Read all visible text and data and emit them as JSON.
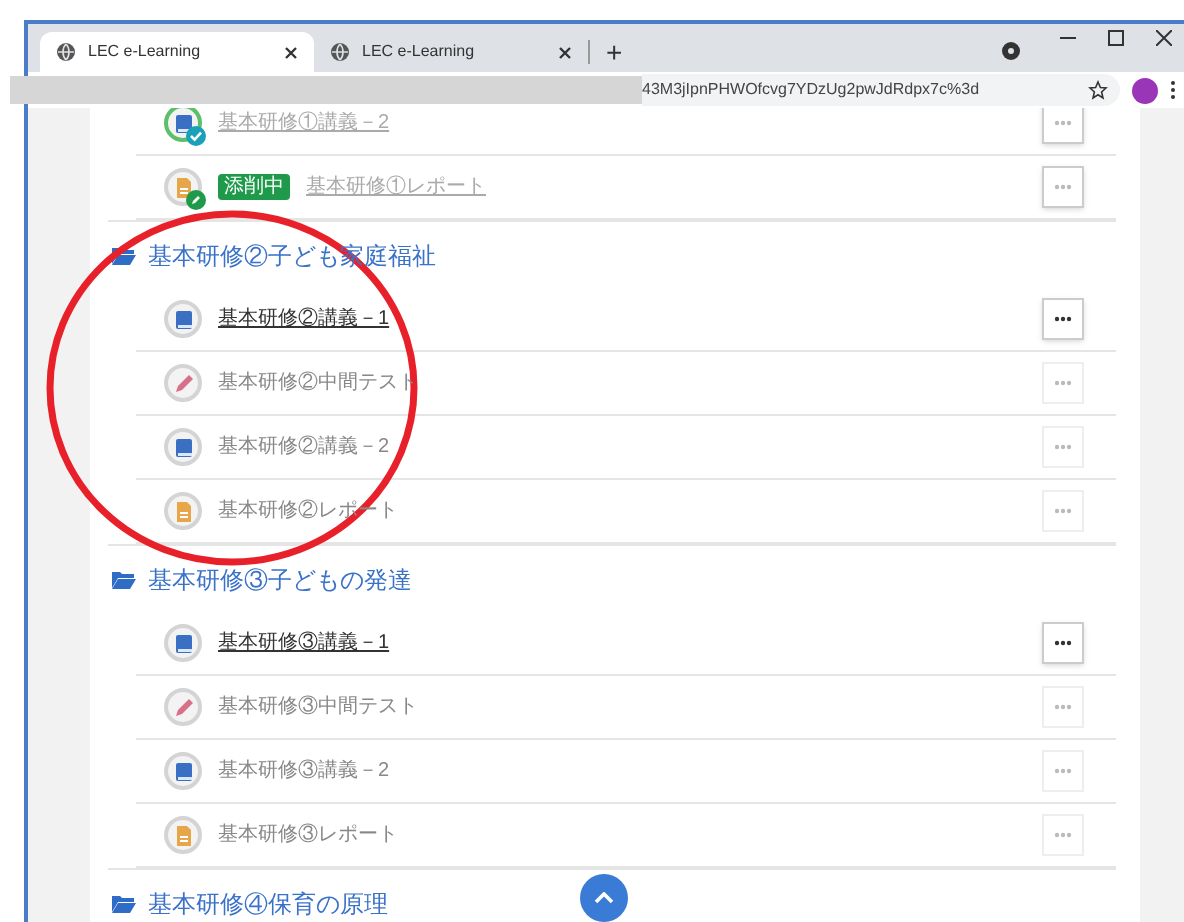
{
  "browser": {
    "tabs": [
      {
        "title": "LEC e-Learning",
        "selected": true
      },
      {
        "title": "LEC e-Learning",
        "selected": false
      }
    ],
    "new_tab": "+",
    "url": "43M3jIpnPHWOfcvg7YDzUg2pwJdRdpx7c%3d"
  },
  "sections": [
    {
      "items": [
        {
          "kind": "book",
          "label": "基本研修①講義－2",
          "available": false,
          "completed": true,
          "in_correction": false
        },
        {
          "kind": "doc",
          "label": "基本研修①レポート",
          "available": false,
          "completed": false,
          "in_correction": true,
          "tag": "添削中"
        }
      ]
    },
    {
      "title": "基本研修②子ども家庭福祉",
      "items": [
        {
          "kind": "book",
          "label": "基本研修②講義－1",
          "available": true,
          "completed": false,
          "in_correction": false
        },
        {
          "kind": "pencil",
          "label": "基本研修②中間テスト",
          "available": false,
          "completed": false,
          "in_correction": false
        },
        {
          "kind": "book",
          "label": "基本研修②講義－2",
          "available": false,
          "completed": false,
          "in_correction": false
        },
        {
          "kind": "doc",
          "label": "基本研修②レポート",
          "available": false,
          "completed": false,
          "in_correction": false
        }
      ]
    },
    {
      "title": "基本研修③子どもの発達",
      "items": [
        {
          "kind": "book",
          "label": "基本研修③講義－1",
          "available": true,
          "completed": false,
          "in_correction": false
        },
        {
          "kind": "pencil",
          "label": "基本研修③中間テスト",
          "available": false,
          "completed": false,
          "in_correction": false
        },
        {
          "kind": "book",
          "label": "基本研修③講義－2",
          "available": false,
          "completed": false,
          "in_correction": false
        },
        {
          "kind": "doc",
          "label": "基本研修③レポート",
          "available": false,
          "completed": false,
          "in_correction": false
        }
      ]
    },
    {
      "title": "基本研修④保育の原理"
    }
  ]
}
